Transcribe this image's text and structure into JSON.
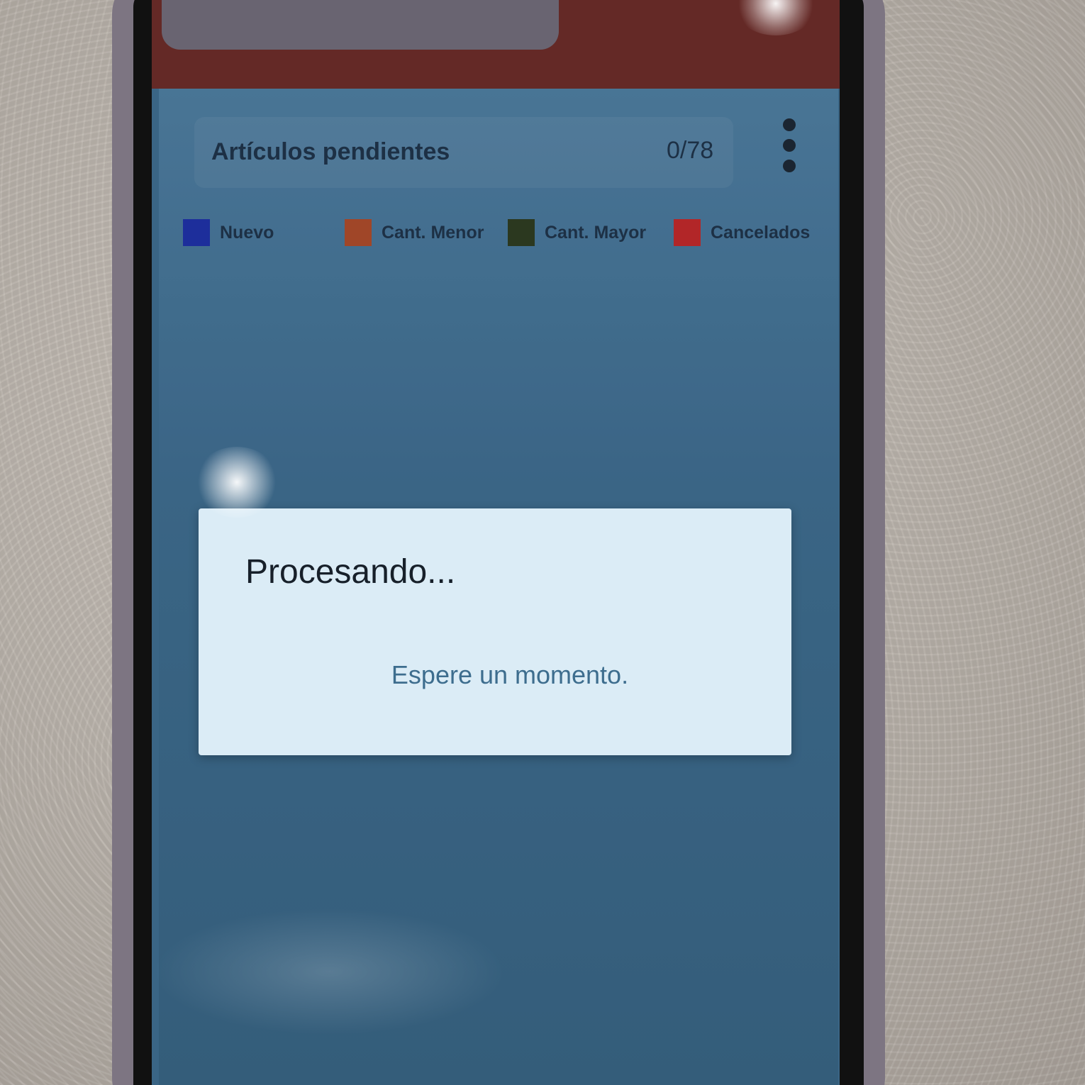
{
  "screen": {
    "pending": {
      "title": "Artículos pendientes",
      "count": "0/78",
      "menu_icon": "more-vert-icon"
    },
    "legend": [
      {
        "label": "Nuevo",
        "color": "#1f2fa6"
      },
      {
        "label": "Cant. Menor",
        "color": "#b04a26"
      },
      {
        "label": "Cant. Mayor",
        "color": "#2e3a1c"
      },
      {
        "label": "Cancelados",
        "color": "#c42626"
      }
    ]
  },
  "dialog": {
    "title": "Procesando...",
    "message": "Espere un momento."
  }
}
